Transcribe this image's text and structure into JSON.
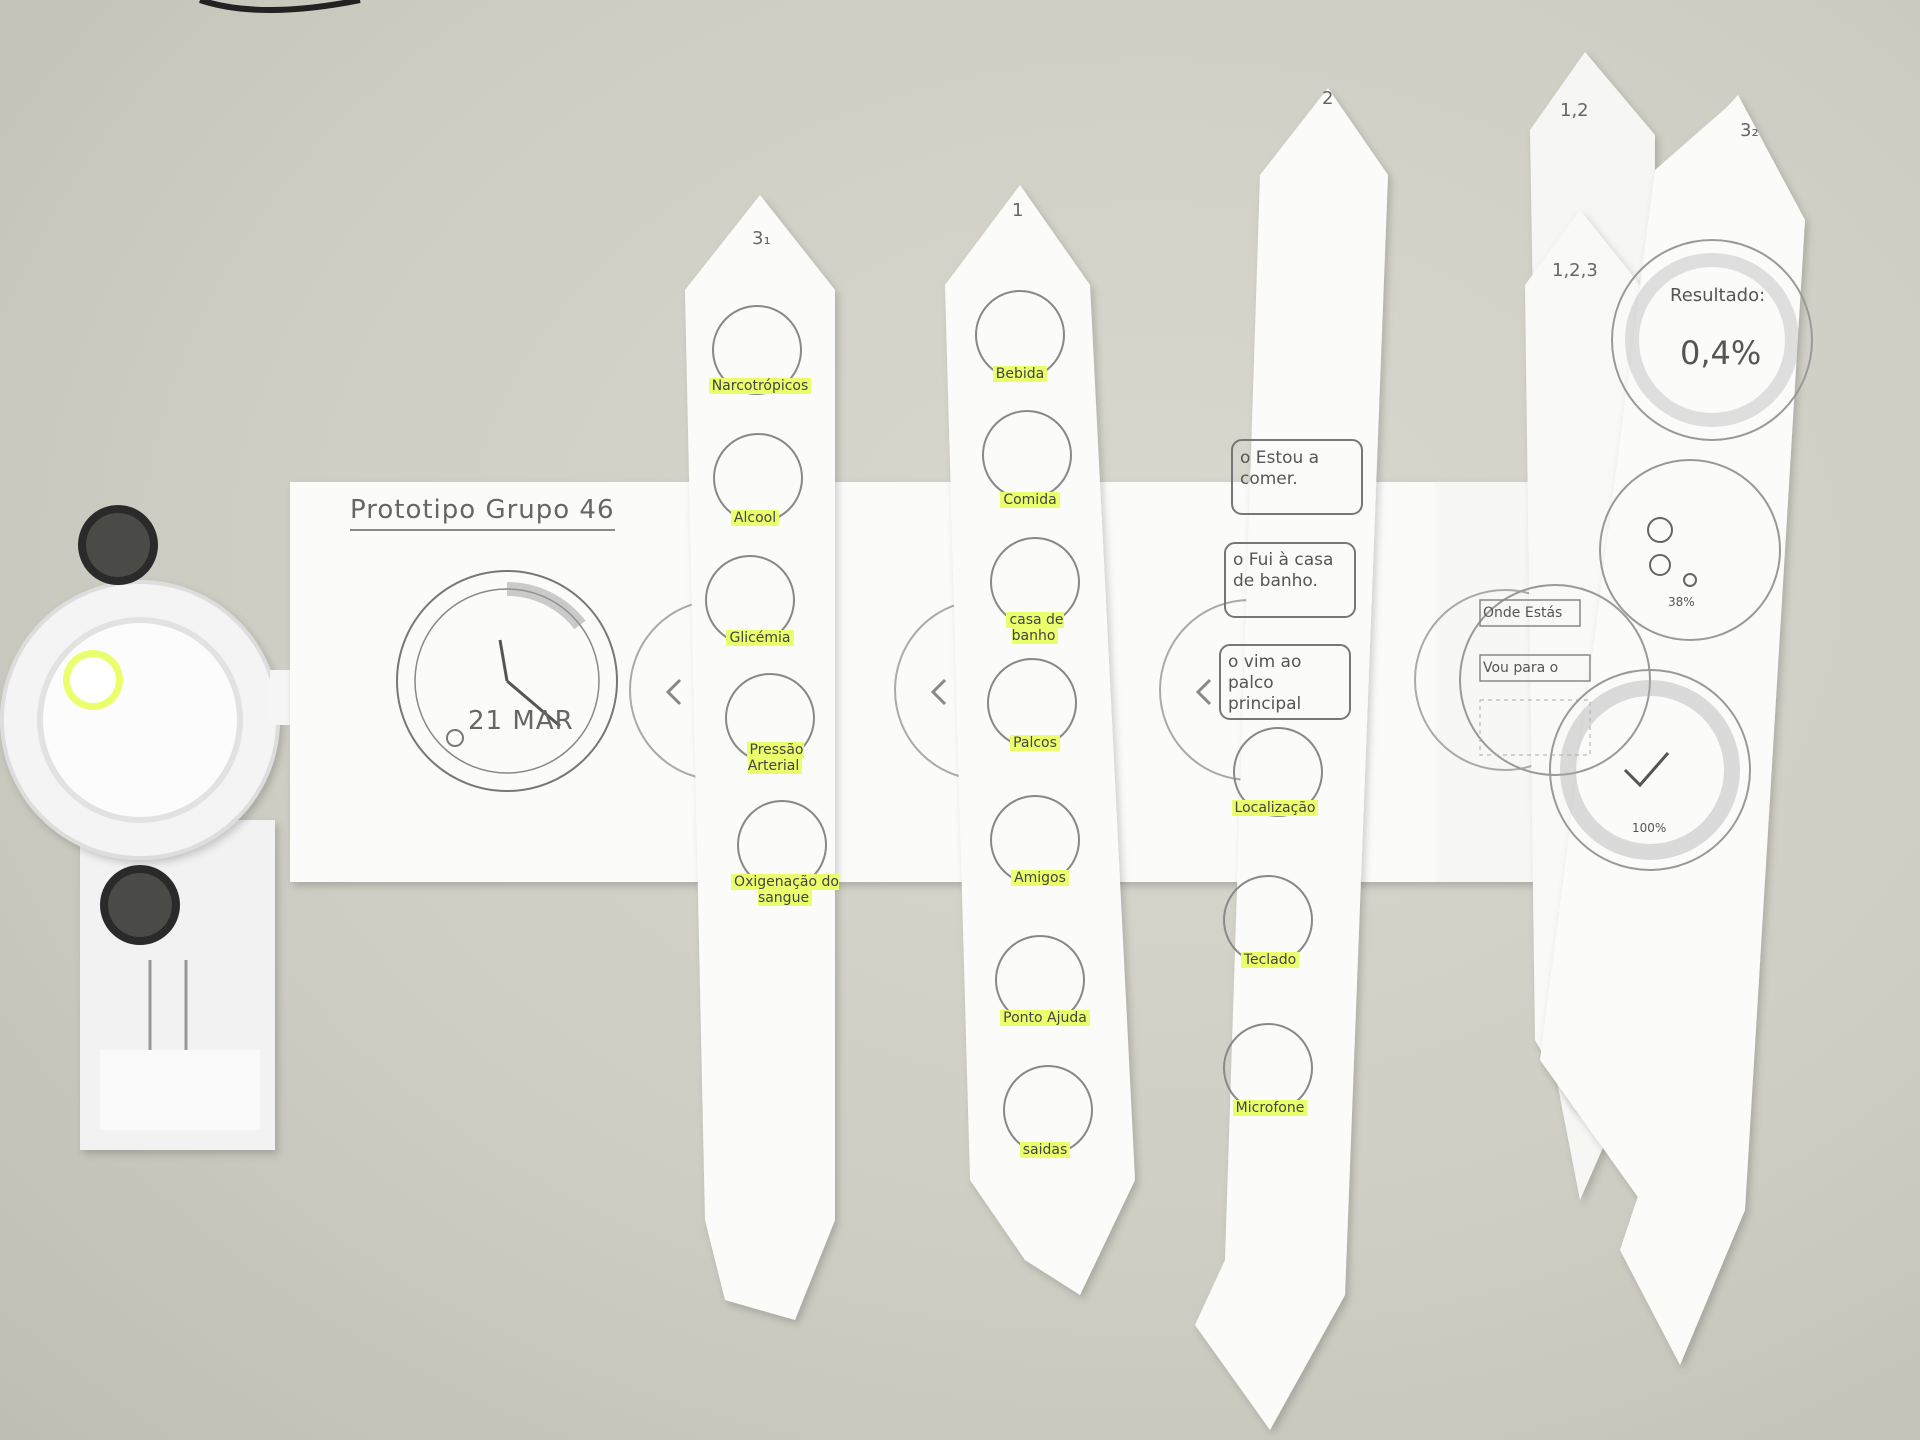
{
  "base_card": {
    "title": "Prototipo Grupo 46",
    "date": "21 MAR"
  },
  "strip_1": {
    "number": "3₁",
    "items": [
      {
        "label": "Narcotrópicos",
        "icon": "syringe-icon"
      },
      {
        "label": "Alcool",
        "icon": "wine-bottle-icon"
      },
      {
        "label": "Glicémia",
        "icon": "glucose-meter-icon"
      },
      {
        "label": "Pressão Arterial",
        "icon": "blood-pressure-icon"
      },
      {
        "label": "Oxigenação do sangue",
        "icon": "oxygen-icon"
      }
    ]
  },
  "strip_2": {
    "number": "1",
    "items": [
      {
        "label": "Bebida",
        "icon": "drink-cup-icon"
      },
      {
        "label": "Comida",
        "icon": "burger-icon"
      },
      {
        "label": "casa de banho",
        "icon": "wc-icon"
      },
      {
        "label": "Palcos",
        "icon": "music-note-icon"
      },
      {
        "label": "Amigos",
        "icon": "friends-icon"
      },
      {
        "label": "Ponto Ajuda",
        "icon": "help-question-icon"
      },
      {
        "label": "saidas",
        "icon": "exit-icon"
      }
    ]
  },
  "strip_3": {
    "number": "2",
    "messages": [
      "o Estou a comer.",
      "o Fui à casa de banho.",
      "o vim ao palco principal"
    ],
    "items": [
      {
        "label": "Localização",
        "icon": "location-pin-icon"
      },
      {
        "label": "Teclado",
        "icon": "keyboard-icon"
      },
      {
        "label": "Microfone",
        "icon": "microphone-icon"
      }
    ]
  },
  "strip_4": {
    "number": "1,2"
  },
  "strip_5": {
    "number": "1,2,3",
    "lines": [
      "Onde Estás",
      "Vou para o"
    ]
  },
  "strip_6": {
    "number": "3₂",
    "result_label": "Resultado:",
    "result_value": "0,4%",
    "progress_label": "38%",
    "progress": 0.38,
    "done_label": "100%"
  },
  "colors": {
    "highlight": "#eaff6b",
    "paper": "#fbfbfa",
    "table": "#cfcec4"
  }
}
